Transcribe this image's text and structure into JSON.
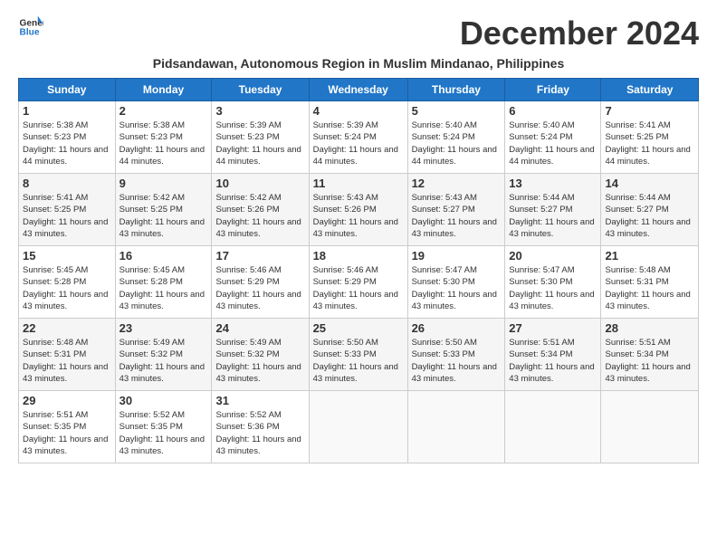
{
  "logo": {
    "line1": "General",
    "line2": "Blue"
  },
  "title": "December 2024",
  "location": "Pidsandawan, Autonomous Region in Muslim Mindanao, Philippines",
  "days_of_week": [
    "Sunday",
    "Monday",
    "Tuesday",
    "Wednesday",
    "Thursday",
    "Friday",
    "Saturday"
  ],
  "weeks": [
    [
      {
        "day": 1,
        "sunrise": "5:38 AM",
        "sunset": "5:23 PM",
        "daylight": "11 hours and 44 minutes."
      },
      {
        "day": 2,
        "sunrise": "5:38 AM",
        "sunset": "5:23 PM",
        "daylight": "11 hours and 44 minutes."
      },
      {
        "day": 3,
        "sunrise": "5:39 AM",
        "sunset": "5:23 PM",
        "daylight": "11 hours and 44 minutes."
      },
      {
        "day": 4,
        "sunrise": "5:39 AM",
        "sunset": "5:24 PM",
        "daylight": "11 hours and 44 minutes."
      },
      {
        "day": 5,
        "sunrise": "5:40 AM",
        "sunset": "5:24 PM",
        "daylight": "11 hours and 44 minutes."
      },
      {
        "day": 6,
        "sunrise": "5:40 AM",
        "sunset": "5:24 PM",
        "daylight": "11 hours and 44 minutes."
      },
      {
        "day": 7,
        "sunrise": "5:41 AM",
        "sunset": "5:25 PM",
        "daylight": "11 hours and 44 minutes."
      }
    ],
    [
      {
        "day": 8,
        "sunrise": "5:41 AM",
        "sunset": "5:25 PM",
        "daylight": "11 hours and 43 minutes."
      },
      {
        "day": 9,
        "sunrise": "5:42 AM",
        "sunset": "5:25 PM",
        "daylight": "11 hours and 43 minutes."
      },
      {
        "day": 10,
        "sunrise": "5:42 AM",
        "sunset": "5:26 PM",
        "daylight": "11 hours and 43 minutes."
      },
      {
        "day": 11,
        "sunrise": "5:43 AM",
        "sunset": "5:26 PM",
        "daylight": "11 hours and 43 minutes."
      },
      {
        "day": 12,
        "sunrise": "5:43 AM",
        "sunset": "5:27 PM",
        "daylight": "11 hours and 43 minutes."
      },
      {
        "day": 13,
        "sunrise": "5:44 AM",
        "sunset": "5:27 PM",
        "daylight": "11 hours and 43 minutes."
      },
      {
        "day": 14,
        "sunrise": "5:44 AM",
        "sunset": "5:27 PM",
        "daylight": "11 hours and 43 minutes."
      }
    ],
    [
      {
        "day": 15,
        "sunrise": "5:45 AM",
        "sunset": "5:28 PM",
        "daylight": "11 hours and 43 minutes."
      },
      {
        "day": 16,
        "sunrise": "5:45 AM",
        "sunset": "5:28 PM",
        "daylight": "11 hours and 43 minutes."
      },
      {
        "day": 17,
        "sunrise": "5:46 AM",
        "sunset": "5:29 PM",
        "daylight": "11 hours and 43 minutes."
      },
      {
        "day": 18,
        "sunrise": "5:46 AM",
        "sunset": "5:29 PM",
        "daylight": "11 hours and 43 minutes."
      },
      {
        "day": 19,
        "sunrise": "5:47 AM",
        "sunset": "5:30 PM",
        "daylight": "11 hours and 43 minutes."
      },
      {
        "day": 20,
        "sunrise": "5:47 AM",
        "sunset": "5:30 PM",
        "daylight": "11 hours and 43 minutes."
      },
      {
        "day": 21,
        "sunrise": "5:48 AM",
        "sunset": "5:31 PM",
        "daylight": "11 hours and 43 minutes."
      }
    ],
    [
      {
        "day": 22,
        "sunrise": "5:48 AM",
        "sunset": "5:31 PM",
        "daylight": "11 hours and 43 minutes."
      },
      {
        "day": 23,
        "sunrise": "5:49 AM",
        "sunset": "5:32 PM",
        "daylight": "11 hours and 43 minutes."
      },
      {
        "day": 24,
        "sunrise": "5:49 AM",
        "sunset": "5:32 PM",
        "daylight": "11 hours and 43 minutes."
      },
      {
        "day": 25,
        "sunrise": "5:50 AM",
        "sunset": "5:33 PM",
        "daylight": "11 hours and 43 minutes."
      },
      {
        "day": 26,
        "sunrise": "5:50 AM",
        "sunset": "5:33 PM",
        "daylight": "11 hours and 43 minutes."
      },
      {
        "day": 27,
        "sunrise": "5:51 AM",
        "sunset": "5:34 PM",
        "daylight": "11 hours and 43 minutes."
      },
      {
        "day": 28,
        "sunrise": "5:51 AM",
        "sunset": "5:34 PM",
        "daylight": "11 hours and 43 minutes."
      }
    ],
    [
      {
        "day": 29,
        "sunrise": "5:51 AM",
        "sunset": "5:35 PM",
        "daylight": "11 hours and 43 minutes."
      },
      {
        "day": 30,
        "sunrise": "5:52 AM",
        "sunset": "5:35 PM",
        "daylight": "11 hours and 43 minutes."
      },
      {
        "day": 31,
        "sunrise": "5:52 AM",
        "sunset": "5:36 PM",
        "daylight": "11 hours and 43 minutes."
      },
      null,
      null,
      null,
      null
    ]
  ]
}
